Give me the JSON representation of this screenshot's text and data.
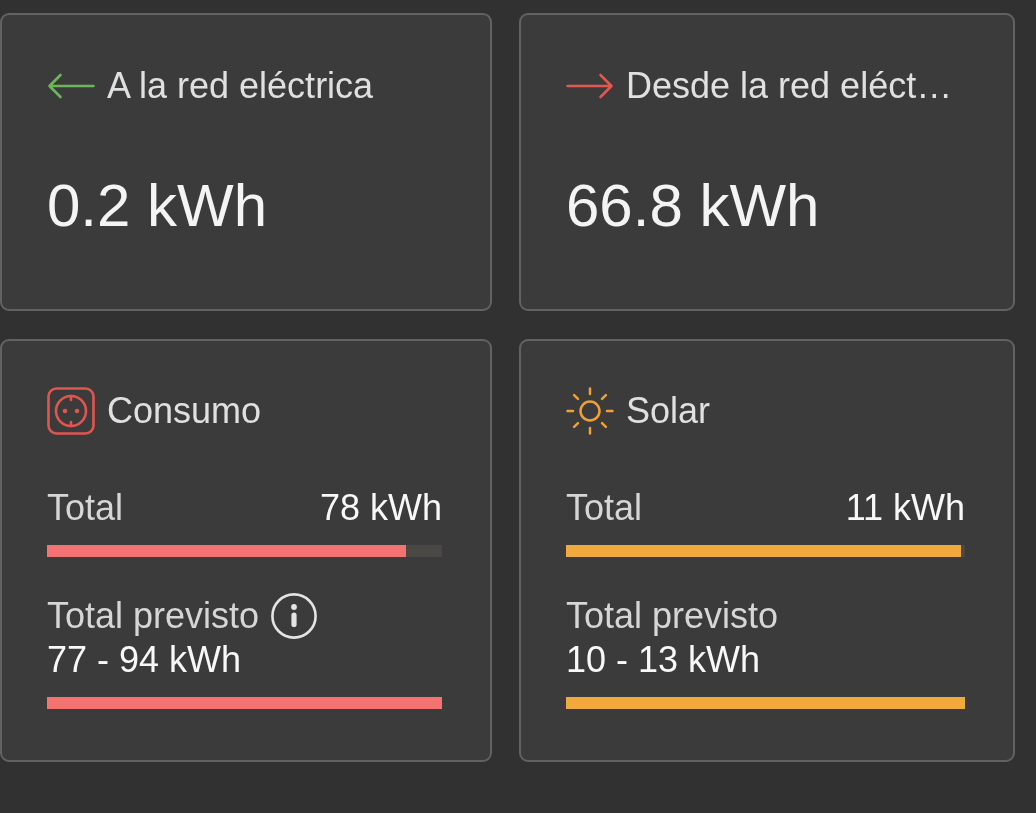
{
  "flows": [
    {
      "kind": "export",
      "label": "A la red eléctrica",
      "value": "0.2 kWh"
    },
    {
      "kind": "import",
      "label": "Desde la red eléct…",
      "value": "66.8 kWh"
    }
  ],
  "meters": [
    {
      "kind": "consumption",
      "label": "Consumo",
      "color": "#f47372",
      "total": {
        "label": "Total",
        "value": "78 kWh",
        "level": 0.91
      },
      "forecast": {
        "label": "Total previsto",
        "info": true,
        "value": "77 - 94 kWh",
        "level": 1
      }
    },
    {
      "kind": "solar",
      "label": "Solar",
      "color": "#f2a93c",
      "total": {
        "label": "Total",
        "value": "11 kWh",
        "level": 0.99
      },
      "forecast": {
        "label": "Total previsto",
        "info": false,
        "value": "10 - 13 kWh",
        "level": 1
      }
    }
  ]
}
